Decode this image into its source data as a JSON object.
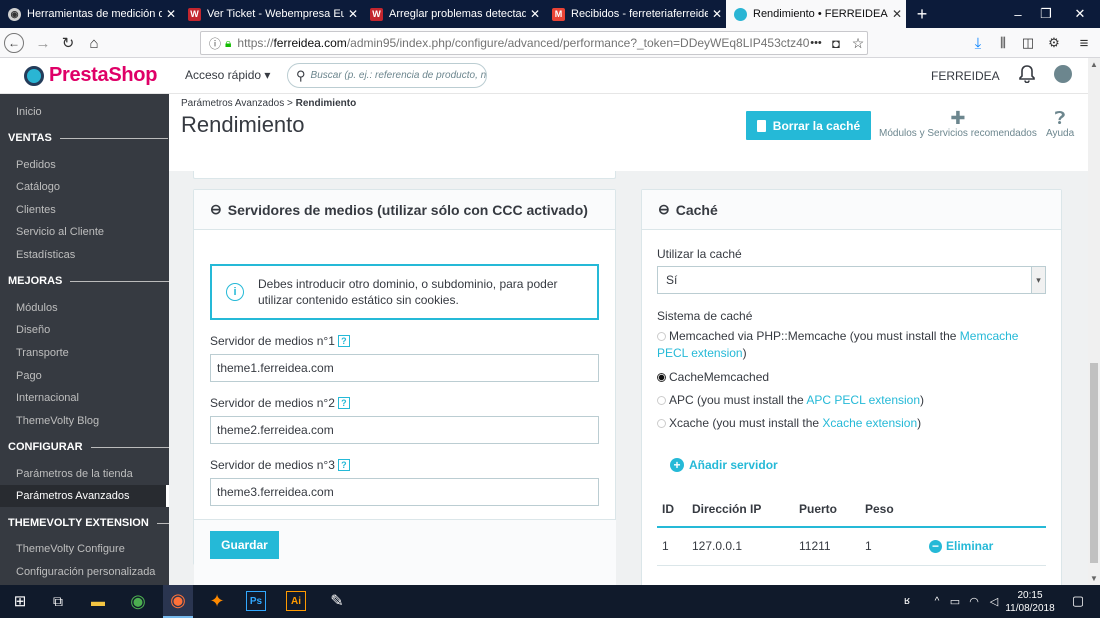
{
  "browser": {
    "tabs": [
      {
        "label": "Herramientas de medición de",
        "icon": "globe-icon"
      },
      {
        "label": "Ver Ticket - Webempresa Europ",
        "icon": "webempresa-icon"
      },
      {
        "label": "Arreglar problemas detectados",
        "icon": "webempresa-icon"
      },
      {
        "label": "Recibidos - ferreteriaferreidea@",
        "icon": "gmail-icon"
      },
      {
        "label": "Rendimiento • FERREIDEA",
        "icon": "prestashop-icon"
      }
    ],
    "url_prefix": "https://",
    "url_host": "ferreidea.com",
    "url_path": "/admin95/index.php/configure/advanced/performance?_token=DDeyWEq8LIP453ctz40",
    "new_tab": "+",
    "menu_more": "•••"
  },
  "header": {
    "logo": "PrestaShop",
    "quick_access": "Acceso rápido ▾",
    "search_placeholder": "Buscar (p. ej.: referencia de producto, n",
    "shop_name": "FERREIDEA"
  },
  "sidebar": {
    "inicio": "Inicio",
    "ventas": "VENTAS",
    "ventas_items": [
      "Pedidos",
      "Catálogo",
      "Clientes",
      "Servicio al Cliente",
      "Estadísticas"
    ],
    "mejoras": "MEJORAS",
    "mejoras_items": [
      "Módulos",
      "Diseño",
      "Transporte",
      "Pago",
      "Internacional",
      "ThemeVolty Blog"
    ],
    "configurar": "CONFIGURAR",
    "configurar_items": [
      "Parámetros de la tienda",
      "Parámetros Avanzados"
    ],
    "themevolty": "THEMEVOLTY EXTENSION",
    "themevolty_items": [
      "ThemeVolty Configure",
      "Configuración personalizada"
    ]
  },
  "toolbar": {
    "breadcrumb_parent": "Parámetros Avanzados",
    "breadcrumb_sep": ">",
    "breadcrumb_current": "Rendimiento",
    "title": "Rendimiento",
    "clear_cache": "Borrar la caché",
    "modules": "Módulos y Servicios recomendados",
    "help": "Ayuda"
  },
  "media_panel": {
    "title": "Servidores de medios (utilizar sólo con CCC activado)",
    "alert": "Debes introducir otro dominio, o subdominio, para poder utilizar contenido estático sin cookies.",
    "fields": [
      {
        "label": "Servidor de medios n°1",
        "value": "theme1.ferreidea.com"
      },
      {
        "label": "Servidor de medios n°2",
        "value": "theme2.ferreidea.com"
      },
      {
        "label": "Servidor de medios n°3",
        "value": "theme3.ferreidea.com"
      }
    ],
    "save": "Guardar",
    "help_mark": "?"
  },
  "cache_panel": {
    "title": "Caché",
    "use_cache_label": "Utilizar la caché",
    "use_cache_value": "Sí",
    "system_label": "Sistema de caché",
    "options": [
      {
        "text": "Memcached via PHP::Memcache (you must install the ",
        "link": "Memcache PECL extension",
        "tail": ")",
        "checked": false
      },
      {
        "text": "CacheMemcached",
        "link": "",
        "tail": "",
        "checked": true
      },
      {
        "text": "APC (you must install the ",
        "link": "APC PECL extension",
        "tail": ")",
        "checked": false
      },
      {
        "text": "Xcache (you must install the ",
        "link": "Xcache extension",
        "tail": ")",
        "checked": false
      }
    ],
    "add_server": "Añadir servidor",
    "table_headers": [
      "ID",
      "Dirección IP",
      "Puerto",
      "Peso"
    ],
    "rows": [
      {
        "id": "1",
        "ip": "127.0.0.1",
        "port": "11211",
        "weight": "1",
        "action": "Eliminar"
      }
    ]
  },
  "taskbar": {
    "time": "20:15",
    "date": "11/08/2018"
  },
  "colors": {
    "accent": "#25b9d7",
    "brand": "#df0067",
    "sidebar": "#363a41"
  }
}
